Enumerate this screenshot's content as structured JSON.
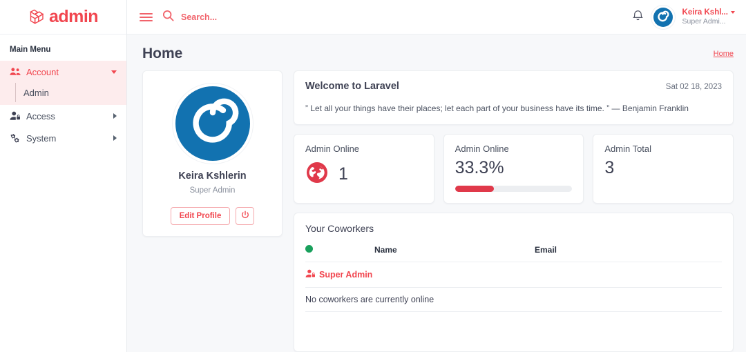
{
  "brand": {
    "text": "admin",
    "logo_icon": "laravel-logo-icon",
    "color": "#f1464f"
  },
  "sidebar": {
    "menu_title": "Main Menu",
    "items": [
      {
        "label": "Account",
        "icon": "users-icon",
        "active": true,
        "expanded": true,
        "caret": "chevron-down-icon"
      },
      {
        "label": "Access",
        "icon": "user-shield-icon",
        "active": false,
        "expanded": false,
        "caret": "chevron-right-icon"
      },
      {
        "label": "System",
        "icon": "cogs-icon",
        "active": false,
        "expanded": false,
        "caret": "chevron-right-icon"
      }
    ],
    "submenu": [
      {
        "label": "Admin"
      }
    ]
  },
  "topbar": {
    "menu_toggle_icon": "hamburger-icon",
    "search_icon": "search-icon",
    "search_placeholder": "Search...",
    "notification_icon": "bell-icon",
    "avatar_icon": "power-swirl-avatar-icon",
    "user_name": "Keira Kshl...",
    "user_role": "Super Admi...",
    "dropdown_icon": "caret-down-icon"
  },
  "page": {
    "title": "Home",
    "breadcrumb": "Home"
  },
  "profile": {
    "avatar_icon": "power-swirl-avatar-icon",
    "name": "Keira Kshlerin",
    "role": "Super Admin",
    "edit_button": "Edit Profile",
    "logout_icon": "power-icon"
  },
  "welcome": {
    "title": "Welcome to Laravel",
    "date": "Sat 02 18, 2023",
    "quote": "” Let all your things have their places; let each part of your business have its time. ” — Benjamin Franklin"
  },
  "stats": [
    {
      "label": "Admin Online",
      "value": "1",
      "icon": "globe-icon",
      "type": "icon-number"
    },
    {
      "label": "Admin Online",
      "value": "33.3%",
      "progress": 33.3,
      "type": "progress"
    },
    {
      "label": "Admin Total",
      "value": "3",
      "type": "number"
    }
  ],
  "coworkers": {
    "title": "Your Coworkers",
    "status_dot": "online-dot-icon",
    "columns": [
      "",
      "Name",
      "Email"
    ],
    "rows": [
      {
        "name": "Super Admin",
        "icon": "user-shield-icon",
        "email": ""
      }
    ],
    "empty_message": "No coworkers are currently online"
  },
  "colors": {
    "accent_red": "#f1464f",
    "progress_red": "#e0394a",
    "avatar_blue": "#1272b0",
    "online_green": "#19a05c",
    "page_bg": "#f7f8fa"
  }
}
